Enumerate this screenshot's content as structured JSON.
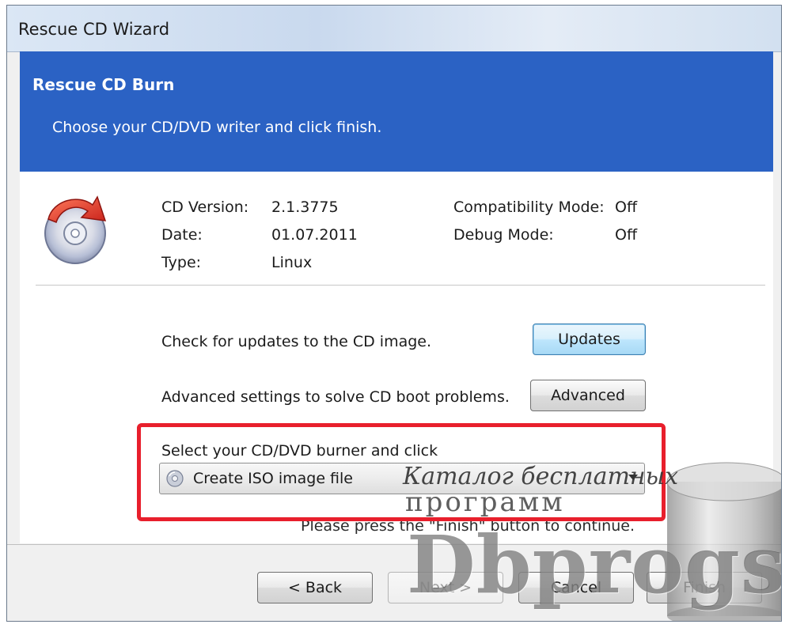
{
  "window": {
    "title": "Rescue CD Wizard"
  },
  "header": {
    "title": "Rescue CD Burn",
    "subtitle": "Choose your CD/DVD writer and click finish."
  },
  "info": {
    "cd_version_label": "CD Version:",
    "cd_version_value": "2.1.3775",
    "date_label": "Date:",
    "date_value": "01.07.2011",
    "type_label": "Type:",
    "type_value": "Linux",
    "compat_label": "Compatibility Mode:",
    "compat_value": "Off",
    "debug_label": "Debug Mode:",
    "debug_value": "Off"
  },
  "actions": {
    "updates_text": "Check for updates to the CD image.",
    "updates_button": "Updates",
    "advanced_text": "Advanced settings to solve CD boot problems.",
    "advanced_button": "Advanced"
  },
  "burner": {
    "label": "Select your CD/DVD burner and click",
    "selected_option": "Create ISO image file",
    "hint": "Please press the \"Finish\" button to continue."
  },
  "footer": {
    "back_button": "< Back",
    "next_button": "Next >",
    "cancel_button": "Cancel",
    "finish_button": "Finish"
  },
  "watermark": {
    "line1": "Каталог бесплатных",
    "line2": "программ",
    "brand": "Dbprogs.ru"
  },
  "colors": {
    "header_blue": "#2b62c4",
    "highlight_red": "#e81f2c"
  },
  "icons": {
    "cd_icon": "cd-disc-with-arrow-icon",
    "combo_icon": "disc-icon",
    "combo_arrow": "chevron-down-icon"
  }
}
